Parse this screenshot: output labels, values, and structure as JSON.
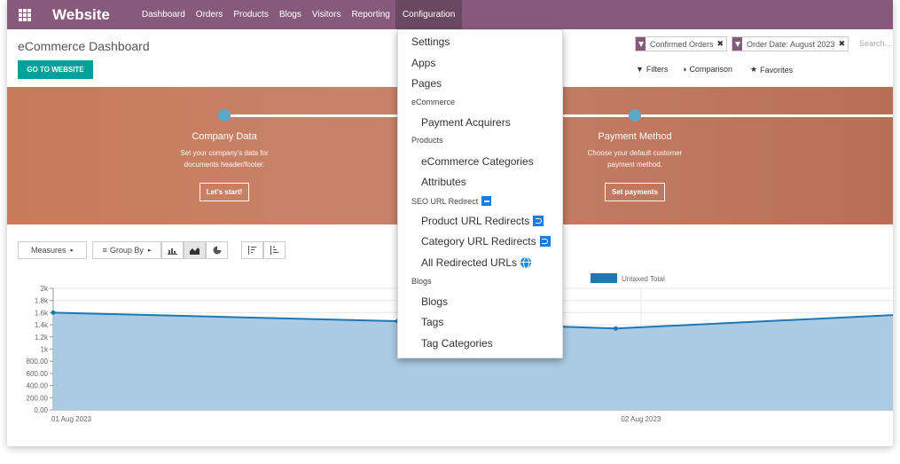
{
  "navbar": {
    "brand": "Website",
    "items": [
      "Dashboard",
      "Orders",
      "Products",
      "Blogs",
      "Visitors",
      "Reporting",
      "Configuration"
    ],
    "active": "Configuration",
    "color": "#875a7b"
  },
  "control_panel": {
    "title": "eCommerce Dashboard",
    "go_button": "GO TO WEBSITE",
    "facets": [
      "Confirmed Orders",
      "Order Date: August 2023"
    ],
    "search_placeholder": "Search...",
    "filters_label": "Filters",
    "comparison_label": "Comparison",
    "favorites_label": "Favorites"
  },
  "banner": {
    "steps": [
      {
        "title": "Company Data",
        "desc1": "Set your company's data for",
        "desc2": "documents header/footer.",
        "button": "Let's start!"
      },
      {
        "title": "Payment Method",
        "desc1": "Choose your default customer",
        "desc2": "payment method.",
        "button": "Set payments"
      }
    ]
  },
  "graph_toolbar": {
    "measures": "Measures",
    "group_by": "Group By"
  },
  "dropdown": {
    "settings": "Settings",
    "apps": "Apps",
    "pages": "Pages",
    "ecommerce_header": "eCommerce",
    "payment_acquirers": "Payment Acquirers",
    "products_header": "Products",
    "ecommerce_categories": "eCommerce Categories",
    "attributes": "Attributes",
    "seo_header": "SEO URL Redirect",
    "product_url_redirects": "Product URL Redirects",
    "category_url_redirects": "Category URL Redirects",
    "all_redirected_urls": "All Redirected URLs",
    "blogs_header": "Blogs",
    "blogs": "Blogs",
    "tags": "Tags",
    "tag_categories": "Tag Categories"
  },
  "chart_data": {
    "type": "area",
    "x": [
      "01 Aug 2023",
      "02 Aug 2023"
    ],
    "series": [
      {
        "name": "Untaxed Total",
        "points": [
          [
            0,
            1600
          ],
          [
            0.41,
            1460
          ],
          [
            0.67,
            1340
          ],
          [
            1,
            1560
          ]
        ]
      }
    ],
    "y_ticks": [
      "0.00",
      "200.00",
      "400.00",
      "600.00",
      "800.00",
      "1k",
      "1.2k",
      "1.4k",
      "1.6k",
      "1.8k",
      "2k"
    ],
    "ylim": [
      0,
      2000
    ],
    "legend": "top",
    "line_color": "#1f77b4",
    "fill_color": "#a6c8e3"
  }
}
